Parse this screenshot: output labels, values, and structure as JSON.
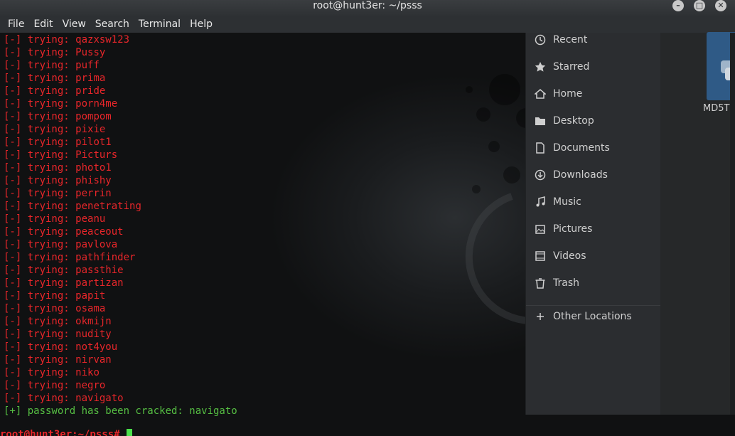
{
  "window": {
    "title": "root@hunt3er: ~/psss",
    "minimize_icon": "minimize-icon",
    "maximize_icon": "maximize-icon",
    "close_icon": "close-icon"
  },
  "menu": [
    "File",
    "Edit",
    "View",
    "Search",
    "Terminal",
    "Help"
  ],
  "terminal": {
    "tried_prefix": "[-] trying: ",
    "tried_words": [
      "qazxsw123",
      "Pussy",
      "puff",
      "prima",
      "pride",
      "porn4me",
      "pompom",
      "pixie",
      "pilot1",
      "Picturs",
      "photo1",
      "phishy",
      "perrin",
      "penetrating",
      "peanu",
      "peaceout",
      "pavlova",
      "pathfinder",
      "passthie",
      "partizan",
      "papit",
      "osama",
      "okmijn",
      "nudity",
      "not4you",
      "nirvan",
      "niko",
      "negro",
      "navigato"
    ],
    "success_line": "[+] password has been cracked: navigato",
    "prompt": "root@hunt3er:~/psss# "
  },
  "file_manager": {
    "places": [
      {
        "label": "Recent",
        "icon": "clock-icon"
      },
      {
        "label": "Starred",
        "icon": "star-icon"
      },
      {
        "label": "Home",
        "icon": "home-icon"
      },
      {
        "label": "Desktop",
        "icon": "folder-icon"
      },
      {
        "label": "Documents",
        "icon": "document-icon"
      },
      {
        "label": "Downloads",
        "icon": "download-icon"
      },
      {
        "label": "Music",
        "icon": "music-icon"
      },
      {
        "label": "Pictures",
        "icon": "pictures-icon"
      },
      {
        "label": "Videos",
        "icon": "videos-icon"
      },
      {
        "label": "Trash",
        "icon": "trash-icon"
      }
    ],
    "other_locations": "Other Locations",
    "other_icon": "plus-icon",
    "file_label": "MD5T"
  },
  "colors": {
    "error": "#e8262a",
    "success": "#56bf43",
    "cursor": "#4be04b"
  }
}
